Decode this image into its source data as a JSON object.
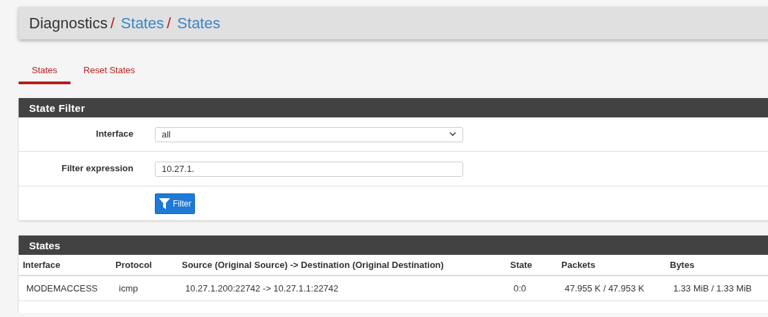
{
  "breadcrumb": {
    "root": "Diagnostics",
    "separator": "/",
    "links": [
      "States",
      "States"
    ]
  },
  "tabs": [
    {
      "label": "States",
      "selected": true
    },
    {
      "label": "Reset States",
      "selected": false
    }
  ],
  "filter_panel": {
    "title": "State Filter",
    "interface": {
      "label": "Interface",
      "value": "all"
    },
    "expression": {
      "label": "Filter expression",
      "value": "10.27.1."
    },
    "button": "Filter"
  },
  "states_panel": {
    "title": "States",
    "columns": [
      "Interface",
      "Protocol",
      "Source (Original Source) -> Destination (Original Destination)",
      "State",
      "Packets",
      "Bytes"
    ],
    "rows": [
      [
        "MODEMACCESS",
        "icmp",
        "10.27.1.200:22742 -> 10.27.1.1:22742",
        "0:0",
        "47.955 K / 47.953 K",
        "1.33 MiB / 1.33 MiB"
      ]
    ]
  }
}
